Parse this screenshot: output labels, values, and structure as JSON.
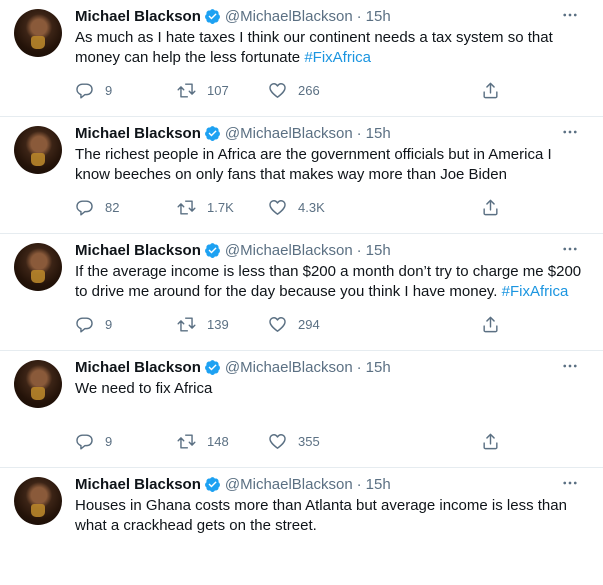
{
  "tweets": [
    {
      "name": "Michael Blackson",
      "handle": "@MichaelBlackson",
      "separator": "·",
      "time": "15h",
      "text": "As much as I hate taxes I think our continent needs a tax system so that money can help the less fortunate ",
      "hashtag": "#FixAfrica",
      "replies": "9",
      "retweets": "107",
      "likes": "266"
    },
    {
      "name": "Michael Blackson",
      "handle": "@MichaelBlackson",
      "separator": "·",
      "time": "15h",
      "text": "The richest people in Africa are the government officials but in America I know beeches on only fans that makes way more than Joe Biden",
      "hashtag": "",
      "replies": "82",
      "retweets": "1.7K",
      "likes": "4.3K"
    },
    {
      "name": "Michael Blackson",
      "handle": "@MichaelBlackson",
      "separator": "·",
      "time": "15h",
      "text": "If the average income is less than $200 a month don’t try to charge me $200 to drive me around for the day because you think I have money. ",
      "hashtag": "#FixAfrica",
      "replies": "9",
      "retweets": "139",
      "likes": "294"
    },
    {
      "name": "Michael Blackson",
      "handle": "@MichaelBlackson",
      "separator": "·",
      "time": "15h",
      "text": "We need to fix Africa",
      "hashtag": "",
      "replies": "9",
      "retweets": "148",
      "likes": "355"
    },
    {
      "name": "Michael Blackson",
      "handle": "@MichaelBlackson",
      "separator": "·",
      "time": "15h",
      "text": "Houses in Ghana costs more than Atlanta but average income is less than what a crackhead gets on the street.",
      "hashtag": "",
      "replies": "",
      "retweets": "",
      "likes": ""
    }
  ],
  "icons": {
    "verified": "verified-badge-icon",
    "more": "more-options-icon",
    "reply": "reply-icon",
    "retweet": "retweet-icon",
    "like": "like-icon",
    "share": "share-icon"
  },
  "colors": {
    "text": "#0f1419",
    "secondary": "#5b7083",
    "hashtag": "#1b95e0",
    "verified": "#1da1f2",
    "divider": "#e6ecf0"
  }
}
